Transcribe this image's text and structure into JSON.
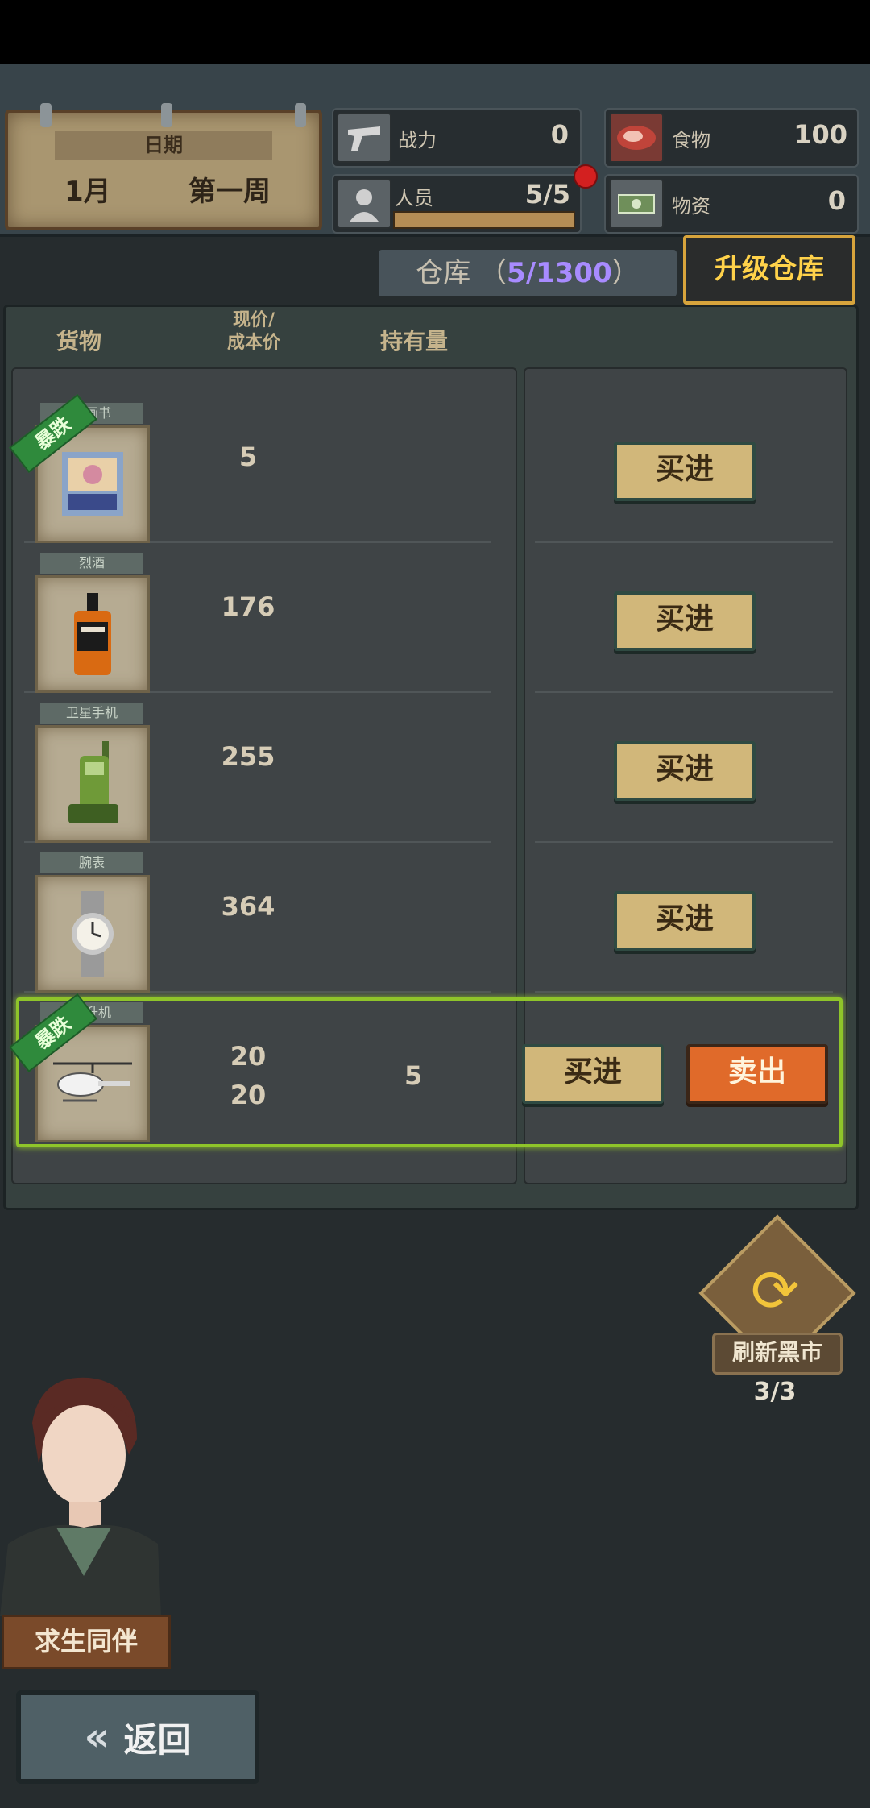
{
  "date": {
    "title": "日期",
    "month": "1月",
    "week": "第一周"
  },
  "stats": {
    "combat": {
      "label": "战力",
      "value": "0",
      "icon": "pistol-icon"
    },
    "food": {
      "label": "食物",
      "value": "100",
      "icon": "meat-icon"
    },
    "people": {
      "label": "人员",
      "value": "5/5",
      "icon": "person-icon"
    },
    "supplies": {
      "label": "物资",
      "value": "0",
      "icon": "cash-icon"
    }
  },
  "warehouse": {
    "label": "仓库",
    "count": "5/1300",
    "upgrade_label": "升级仓库"
  },
  "table_headers": {
    "goods": "货物",
    "price_line1": "现价/",
    "price_line2": "成本价",
    "holding": "持有量"
  },
  "buy_label": "买进",
  "sell_label": "卖出",
  "drop_badge": "暴跌",
  "items": [
    {
      "tag": "漫画书",
      "icon": "comic-book-icon",
      "price": "5",
      "cost": "",
      "holding": "",
      "drop": true
    },
    {
      "tag": "烈酒",
      "icon": "whiskey-bottle-icon",
      "price": "176",
      "cost": "",
      "holding": "",
      "drop": false
    },
    {
      "tag": "卫星手机",
      "icon": "satellite-phone-icon",
      "price": "255",
      "cost": "",
      "holding": "",
      "drop": false
    },
    {
      "tag": "腕表",
      "icon": "wristwatch-icon",
      "price": "364",
      "cost": "",
      "holding": "",
      "drop": false
    },
    {
      "tag": "直升机",
      "icon": "helicopter-icon",
      "price": "20",
      "cost": "20",
      "holding": "5",
      "drop": true
    }
  ],
  "refresh": {
    "label": "刷新黑市",
    "count": "3/3"
  },
  "companion": {
    "label": "求生同伴"
  },
  "back": {
    "label": "返回"
  }
}
